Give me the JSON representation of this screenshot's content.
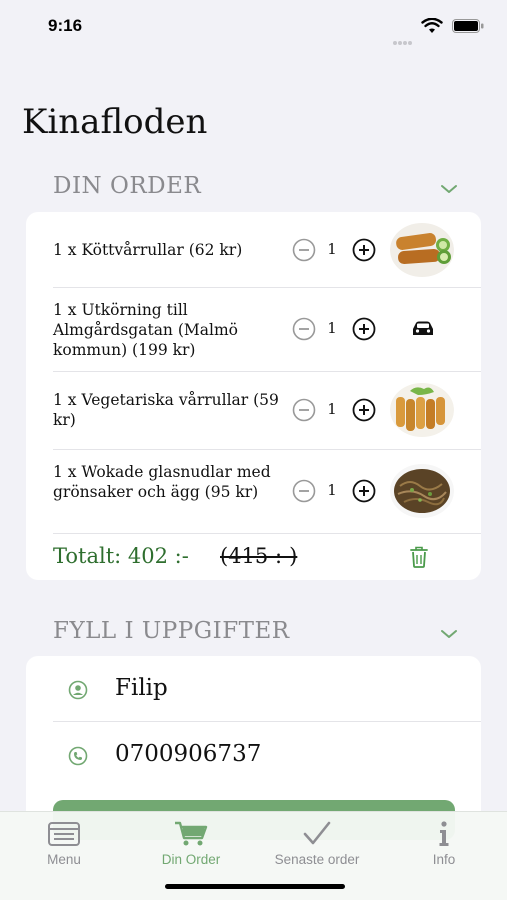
{
  "status_bar": {
    "time": "9:16"
  },
  "app": {
    "title": "Kinafloden"
  },
  "order_section": {
    "header": "DIN ORDER",
    "items": [
      {
        "text": "1 x Köttvårrullar (62 kr)",
        "qty": "1",
        "image": "spring-rolls-meat-image"
      },
      {
        "text": "1 x Utkörning till Almgårdsgatan (Malmö kommun) (199 kr)",
        "qty": "1",
        "image": "car-icon"
      },
      {
        "text": "1 x Vegetariska vårrullar (59 kr)",
        "qty": "1",
        "image": "spring-rolls-veg-image"
      },
      {
        "text": "1 x Wokade glasnudlar med grönsaker och ägg (95 kr)",
        "qty": "1",
        "image": "glass-noodles-image"
      }
    ],
    "total_label": "Totalt: 402 :-",
    "total_original": "(415 :-)"
  },
  "details_section": {
    "header": "FYLL I UPPGIFTER",
    "name_value": "Filip",
    "phone_value": "0700906737"
  },
  "tab_bar": {
    "tabs": [
      {
        "label": "Menu",
        "icon": "menu-card-icon",
        "active": false
      },
      {
        "label": "Din Order",
        "icon": "cart-icon",
        "active": true
      },
      {
        "label": "Senaste order",
        "icon": "checkmark-icon",
        "active": false
      },
      {
        "label": "Info",
        "icon": "info-icon",
        "active": false
      }
    ]
  },
  "colors": {
    "accent_green": "#72a872",
    "total_green": "#2e6e2e",
    "background": "#f2f2f7",
    "section_header_gray": "#8a8a8e"
  }
}
